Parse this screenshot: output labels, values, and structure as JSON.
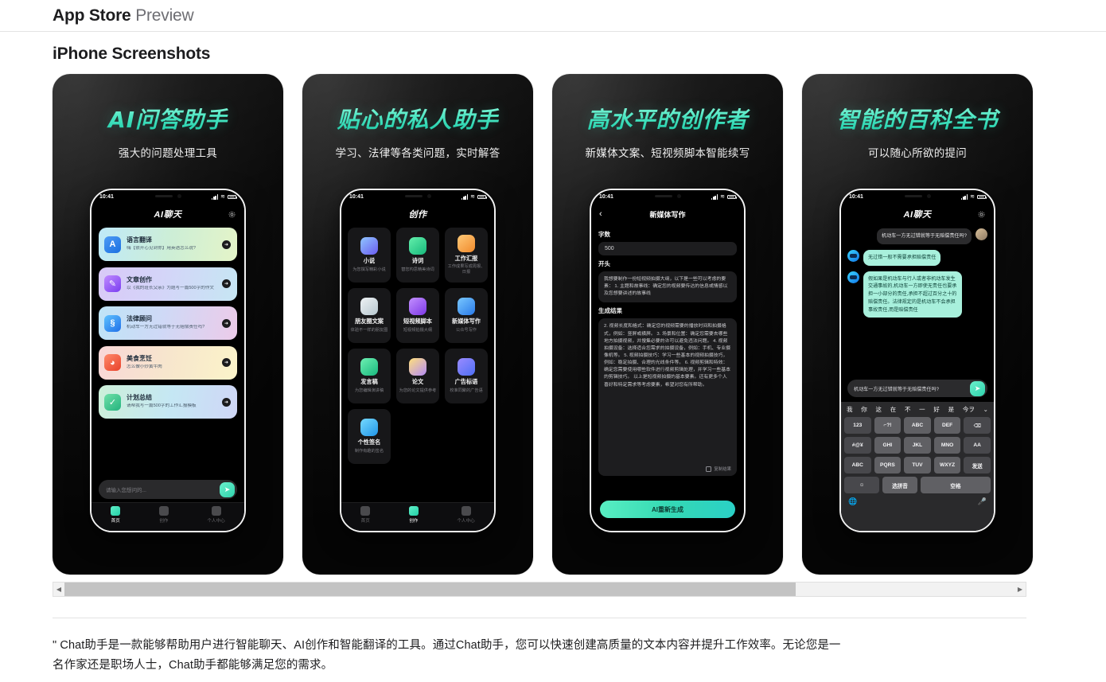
{
  "header": {
    "brand": "App Store",
    "sub": "Preview"
  },
  "section": {
    "title": "iPhone Screenshots"
  },
  "scrollbar": {
    "left_arrow": "◀",
    "right_arrow": "▶"
  },
  "description": "\" Chat助手是一款能够帮助用户进行智能聊天、AI创作和智能翻译的工具。通过Chat助手，您可以快速创建高质量的文本内容并提升工作效率。无论您是一名作家还是职场人士，Chat助手都能够满足您的需求。",
  "colors": {
    "brand_mint": "#3ee0bb",
    "shot_bg": "#0d0d0d",
    "accent_text": "#4ee6c3",
    "scroll_thumb": "#c3c3c3"
  },
  "shots": [
    {
      "title": "AI问答助手",
      "subtitle": "强大的问题处理工具",
      "phone": {
        "time": "10:41",
        "nav_title": "AI聊天",
        "gear_icon": "gear-icon",
        "input_placeholder": "请输入您想问的...",
        "send_icon": "send-icon",
        "cards": [
          {
            "title": "语言翻译",
            "desc": "嗨【很开心见到你】用英语怎么说?",
            "icon": "translate-icon",
            "arrow": "➜"
          },
          {
            "title": "文章创作",
            "desc": "以《我的班长父亲》为题写一篇500字的作文",
            "icon": "edit-icon",
            "arrow": "➜"
          },
          {
            "title": "法律顾问",
            "desc": "机动车一方无过错就等于无赔偿责任吗?",
            "icon": "law-icon",
            "arrow": "➜"
          },
          {
            "title": "美食烹饪",
            "desc": "怎么做小炒黄牛肉",
            "icon": "food-icon",
            "arrow": "➜"
          },
          {
            "title": "计划总结",
            "desc": "请帮我写一篇500字的工作汇报模板",
            "icon": "plan-icon",
            "arrow": "➜"
          }
        ],
        "tabs": [
          {
            "label": "首页",
            "icon": "home-icon",
            "active": true
          },
          {
            "label": "创作",
            "icon": "create-icon",
            "active": false
          },
          {
            "label": "个人中心",
            "icon": "profile-icon",
            "active": false
          }
        ]
      }
    },
    {
      "title": "贴心的私人助手",
      "subtitle": "学习、法律等各类问题，实时解答",
      "phone": {
        "time": "10:41",
        "nav_title": "创作",
        "grid": [
          {
            "title": "小说",
            "desc": "为您撰写精彩小说",
            "icon": "novel-icon"
          },
          {
            "title": "诗词",
            "desc": "替您构思精美诗词",
            "icon": "poem-icon"
          },
          {
            "title": "工作汇报",
            "desc": "工作成果写成周报、日报",
            "icon": "report-icon"
          },
          {
            "title": "朋友圈文案",
            "desc": "体验不一样的朋友圈",
            "icon": "moments-icon"
          },
          {
            "title": "短视频脚本",
            "desc": "短视频拍摄大纲",
            "icon": "video-script-icon"
          },
          {
            "title": "新媒体写作",
            "desc": "公众号写作",
            "icon": "newmedia-icon"
          },
          {
            "title": "发言稿",
            "desc": "为您编辑演讲稿",
            "icon": "speech-icon"
          },
          {
            "title": "论文",
            "desc": "为您的论文提供参考",
            "icon": "thesis-icon"
          },
          {
            "title": "广告标语",
            "desc": "校准同聚的广告语",
            "icon": "ad-icon"
          },
          {
            "title": "个性签名",
            "desc": "制作有趣的签名",
            "icon": "signature-icon"
          }
        ],
        "tabs": [
          {
            "label": "首页",
            "icon": "home-icon",
            "active": false
          },
          {
            "label": "创作",
            "icon": "create-icon",
            "active": true
          },
          {
            "label": "个人中心",
            "icon": "profile-icon",
            "active": false
          }
        ]
      }
    },
    {
      "title": "高水平的创作者",
      "subtitle": "新媒体文案、短视频脚本智能续写",
      "phone": {
        "time": "10:41",
        "nav_title": "新媒体写作",
        "back_icon": "chevron-left-icon",
        "label_count": "字数",
        "value_count": "500",
        "label_start": "开头",
        "text_start": "我想要制作一份短视频拍摄大纲，以下是一些可以考虑的要素：\n1. 主题和故事线：确定您的视频要传达的信息或情感以及您想要讲述的故事线",
        "label_result": "生成结果",
        "text_result": "2. 视频长度和格式：确定您的视频需要的播放时间和拍摄格式，例如：竖屏或横屏。\n3. 场景和位置：确定您需要去哪些地方拍摄视频，并搜集必要的许可以避免违法问题。\n4. 视频拍摄设备：选择适合您需求的拍摄设备，例如：手机、专业摄像机等。\n5. 视频拍摄技巧：学习一些基本的视频拍摄技巧，例如：稳定拍摄、合理的光线条件等。\n6. 视频剪辑和特效：确定您需要使用哪些软件进行视频剪辑处理，并学习一些基本的剪辑技巧。\n以上是短视频拍摄的基本要素。还有更多个人喜好和特定需求等考虑要素，希望对您有所帮助。",
        "copy_label": "复制结果",
        "copy_icon": "copy-icon",
        "cta_label": "AI重新生成"
      }
    },
    {
      "title": "智能的百科全书",
      "subtitle": "可以随心所欲的提问",
      "phone": {
        "time": "10:41",
        "nav_title": "AI聊天",
        "gear_icon": "gear-icon",
        "messages": [
          {
            "from": "me",
            "text": "机动车一方无过错就等于无赔偿责任吗?"
          },
          {
            "from": "bot",
            "text": "无过错一般不需要承担赔偿责任"
          },
          {
            "from": "bot",
            "text": "假如果是机动车与行人或者非机动车发生交通事故的,机动车一方即使无责任也要承担一小部分的责任,承担不超过百分之十的赔偿责任。法律规定的是机动车不会承担事故责任,而是赔偿责任"
          }
        ],
        "input_value": "机动车一方无过错就等于无赔偿责任吗?",
        "send_icon": "send-icon",
        "keyboard": {
          "suggestions": [
            "我",
            "你",
            "这",
            "在",
            "不",
            "一",
            "好",
            "是",
            "今ヲ"
          ],
          "expand_icon": "chevron-down-icon",
          "rows": [
            [
              "123",
              "⌐?!",
              "ABC",
              "DEF",
              "⌫"
            ],
            [
              "#@¥",
              "GHI",
              "JKL",
              "MNO",
              "AA"
            ],
            [
              "ABC",
              "PQRS",
              "TUV",
              "WXYZ",
              "发送"
            ],
            [
              "☺",
              "选拼音",
              "空格"
            ]
          ],
          "globe_icon": "globe-icon",
          "mic_icon": "microphone-icon"
        }
      }
    }
  ]
}
